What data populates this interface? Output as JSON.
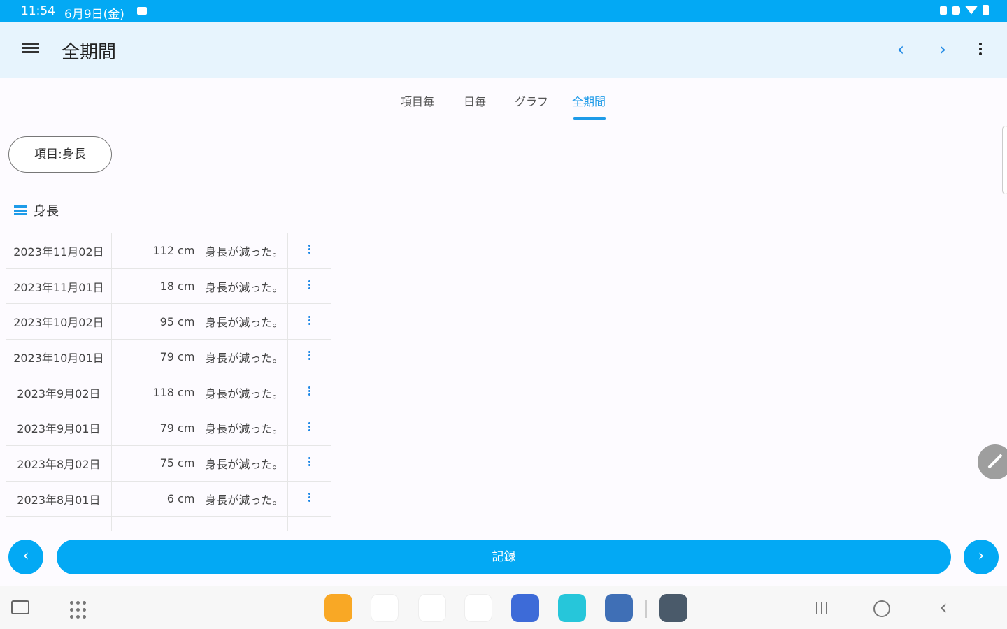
{
  "status_bar": {
    "time": "11:54",
    "date": "6月9日(金)"
  },
  "app_bar": {
    "title": "全期間",
    "prev_glyph": "‹",
    "next_glyph": "›"
  },
  "tabs": [
    {
      "label": "項目毎",
      "active": false
    },
    {
      "label": "日毎",
      "active": false
    },
    {
      "label": "グラフ",
      "active": false
    },
    {
      "label": "全期間",
      "active": true
    }
  ],
  "filter_chip": {
    "label": "項目:身長"
  },
  "section": {
    "title": "身長"
  },
  "records": [
    {
      "date": "2023年11月02日",
      "value": "112 cm",
      "memo": "身長が減った。"
    },
    {
      "date": "2023年11月01日",
      "value": "18 cm",
      "memo": "身長が減った。"
    },
    {
      "date": "2023年10月02日",
      "value": "95 cm",
      "memo": "身長が減った。"
    },
    {
      "date": "2023年10月01日",
      "value": "79 cm",
      "memo": "身長が減った。"
    },
    {
      "date": "2023年9月02日",
      "value": "118 cm",
      "memo": "身長が減った。"
    },
    {
      "date": "2023年9月01日",
      "value": "79 cm",
      "memo": "身長が減った。"
    },
    {
      "date": "2023年8月02日",
      "value": "75 cm",
      "memo": "身長が減った。"
    },
    {
      "date": "2023年8月01日",
      "value": "6 cm",
      "memo": "身長が減った。"
    }
  ],
  "bottom_bar": {
    "record_label": "記録",
    "prev_glyph": "‹",
    "next_glyph": "›"
  },
  "dock": [
    {
      "name": "files",
      "color": "#f9a825"
    },
    {
      "name": "chrome",
      "color": "#ffffff"
    },
    {
      "name": "gmail",
      "color": "#ffffff"
    },
    {
      "name": "youtube",
      "color": "#ffffff"
    },
    {
      "name": "music",
      "color": "#3d6bd8"
    },
    {
      "name": "app-teal",
      "color": "#26c6da"
    },
    {
      "name": "app-blue",
      "color": "#3f6fb6"
    },
    {
      "name": "settings",
      "color": "#4a5a6a"
    }
  ],
  "colors": {
    "accent": "#03a9f4",
    "tab_active": "#1e9be8",
    "app_bar_bg": "#e7f4fd"
  }
}
